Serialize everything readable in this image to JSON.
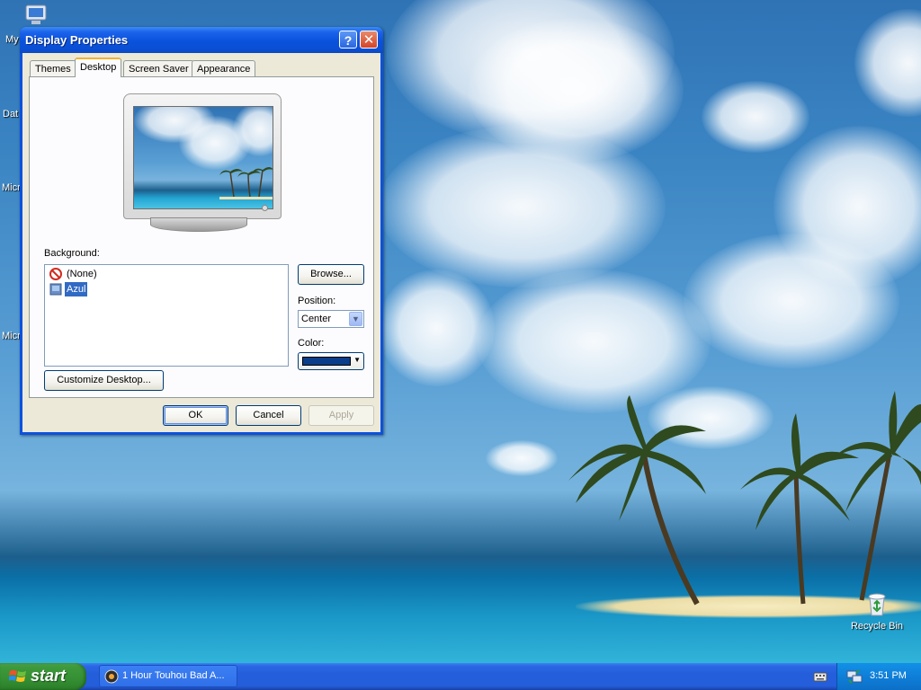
{
  "dialog": {
    "title": "Display Properties",
    "help_symbol": "?",
    "close_symbol": "✕",
    "tabs": [
      {
        "label": "Themes",
        "active": false
      },
      {
        "label": "Desktop",
        "active": true
      },
      {
        "label": "Screen Saver",
        "active": false
      },
      {
        "label": "Appearance",
        "active": false
      }
    ],
    "background_label": "Background:",
    "background_items": [
      {
        "label": "(None)",
        "icon": "no-entry-icon",
        "selected": false
      },
      {
        "label": "Azul",
        "icon": "image-file-icon",
        "selected": true
      }
    ],
    "browse_label": "Browse...",
    "position_label": "Position:",
    "position_value": "Center",
    "color_label": "Color:",
    "color_value": "#0a3d8a",
    "customize_label": "Customize Desktop...",
    "ok_label": "OK",
    "cancel_label": "Cancel",
    "apply_label": "Apply"
  },
  "desktop": {
    "icons": [
      {
        "label": "My",
        "icon": "computer-icon"
      },
      {
        "label": "Dat",
        "icon": "folder-icon"
      },
      {
        "label": "Micr",
        "icon": "app-icon"
      },
      {
        "label": "Micr",
        "icon": "app-icon"
      },
      {
        "label": "Recycle Bin",
        "icon": "recycle-bin-icon"
      }
    ]
  },
  "taskbar": {
    "start_label": "start",
    "task_label": "1 Hour Touhou Bad A...",
    "clock": "3:51 PM"
  },
  "colors": {
    "titlebar": "#0a52dc",
    "taskbar": "#245edb",
    "start_button": "#3d9a3b",
    "tray": "#0f7fd8",
    "selection": "#316ac5"
  }
}
